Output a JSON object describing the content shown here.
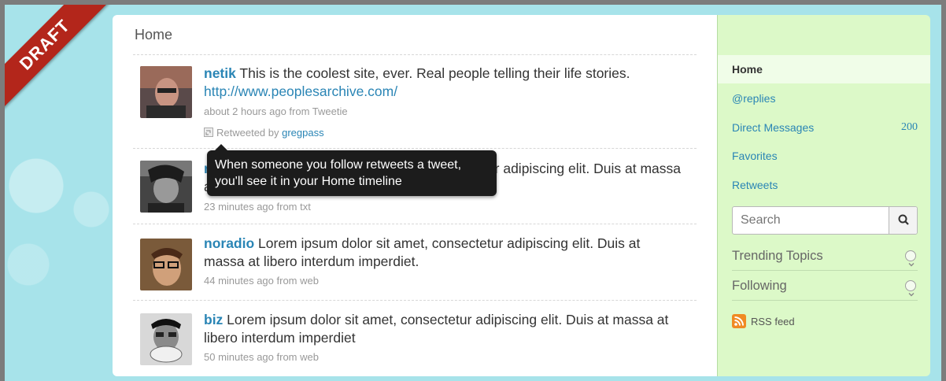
{
  "ribbon": {
    "label": "DRAFT"
  },
  "timeline": {
    "title": "Home",
    "tweets": [
      {
        "user": "netik",
        "text": " This is the coolest site, ever. Real people telling their life stories. ",
        "link": "http://www.peoplesarchive.com/",
        "meta": "about 2 hours ago from Tweetie",
        "retweet_prefix": "Retweeted by ",
        "retweet_user": "gregpass"
      },
      {
        "user": "rsarver",
        "text": " Lorem ipsum dolor sit amet, consectetur adipiscing elit. Duis at massa at libero interdum imperdiet.",
        "meta": "23 minutes ago from txt"
      },
      {
        "user": "noradio",
        "text": " Lorem ipsum dolor sit amet, consectetur adipiscing elit. Duis at massa at libero interdum imperdiet.",
        "meta": "44 minutes ago from web"
      },
      {
        "user": "biz",
        "text": " Lorem ipsum dolor sit amet, consectetur adipiscing elit. Duis at massa at libero interdum imperdiet",
        "meta": "50 minutes ago from web"
      }
    ],
    "tooltip": "When someone you follow retweets a tweet, you'll see it in your Home timeline"
  },
  "sidebar": {
    "nav": [
      {
        "label": "Home",
        "active": true
      },
      {
        "label": "@replies"
      },
      {
        "label": "Direct Messages",
        "count": "200"
      },
      {
        "label": "Favorites"
      },
      {
        "label": "Retweets"
      }
    ],
    "search_placeholder": "Search",
    "sections": [
      {
        "label": "Trending Topics"
      },
      {
        "label": "Following"
      }
    ],
    "rss_label": "RSS feed"
  },
  "colors": {
    "link": "#2a85b5",
    "ribbon": "#b3261b",
    "sidebar_bg": "#dcf9c8",
    "page_bg": "#a7e3ea"
  },
  "icons": {
    "search": "magnifier-icon",
    "retweet": "retweet-icon",
    "rss": "rss-icon",
    "chevron": "chevron-down-icon"
  }
}
